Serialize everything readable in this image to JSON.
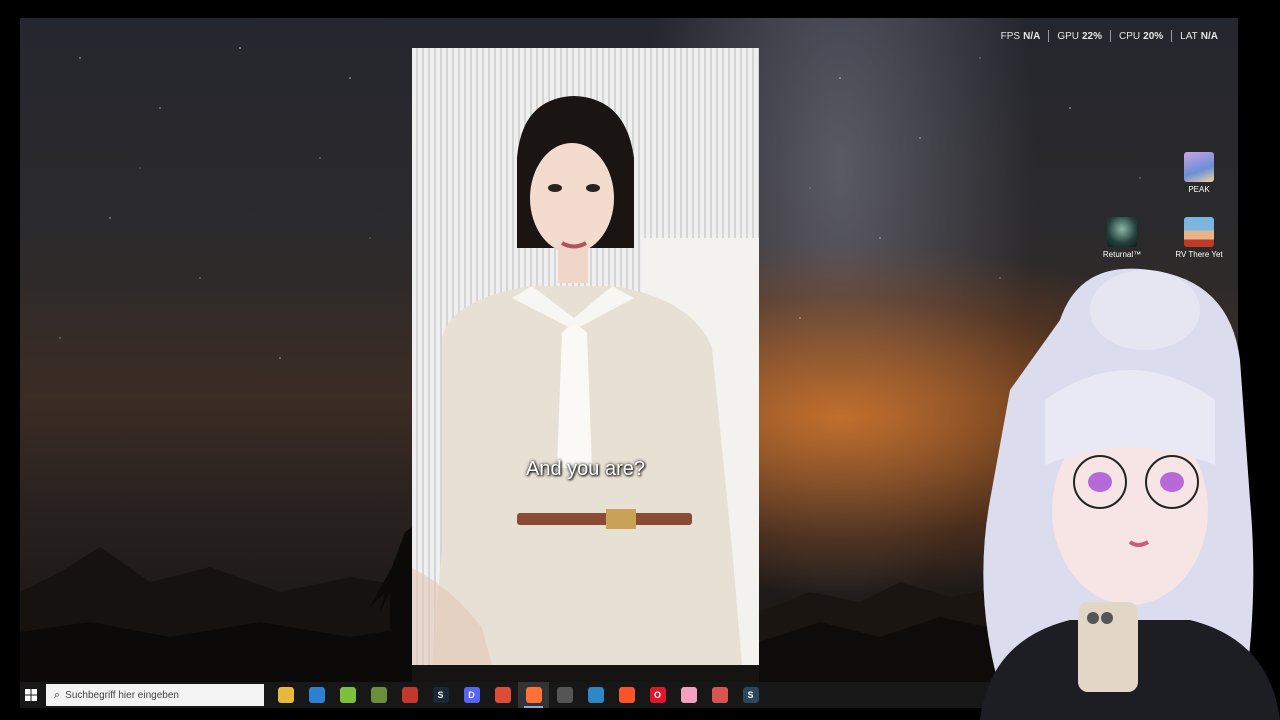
{
  "hud": {
    "fps_label": "FPS",
    "fps_value": "N/A",
    "gpu_label": "GPU",
    "gpu_value": "22%",
    "cpu_label": "CPU",
    "cpu_value": "20%",
    "lat_label": "LAT",
    "lat_value": "N/A"
  },
  "desktop_icons": [
    {
      "label": "PEAK",
      "icon": "peak-icon"
    },
    {
      "label": "Returnal™",
      "icon": "returnal-icon"
    },
    {
      "label": "RV There Yet",
      "icon": "rv-there-yet-icon"
    }
  ],
  "video": {
    "subtitle": "And you are?"
  },
  "taskbar": {
    "search_placeholder": "Suchbegriff hier eingeben",
    "apps": [
      {
        "name": "file-explorer-icon",
        "glyph": "",
        "color": "#e8b83a",
        "active": false
      },
      {
        "name": "ms-store-icon",
        "glyph": "",
        "color": "#2d7fd3",
        "active": false
      },
      {
        "name": "android-app-icon",
        "glyph": "",
        "color": "#7cbf3d",
        "active": false
      },
      {
        "name": "minecraft-icon",
        "glyph": "",
        "color": "#6a8e3a",
        "active": false
      },
      {
        "name": "notes-app-icon",
        "glyph": "",
        "color": "#c0392b",
        "active": false
      },
      {
        "name": "steam-icon",
        "glyph": "S",
        "color": "#1b2838",
        "active": false
      },
      {
        "name": "discord-icon",
        "glyph": "D",
        "color": "#5865f2",
        "active": false
      },
      {
        "name": "chrome-icon",
        "glyph": "",
        "color": "#dd4b39",
        "active": false
      },
      {
        "name": "firefox-icon",
        "glyph": "",
        "color": "#ff7139",
        "active": true
      },
      {
        "name": "dashboard-icon",
        "glyph": "",
        "color": "#555555",
        "active": false
      },
      {
        "name": "vpn-icon",
        "glyph": "",
        "color": "#2f86c7",
        "active": false
      },
      {
        "name": "brave-icon",
        "glyph": "",
        "color": "#fb542b",
        "active": false
      },
      {
        "name": "opera-icon",
        "glyph": "O",
        "color": "#e0162b",
        "active": false
      },
      {
        "name": "pink-app-icon",
        "glyph": "",
        "color": "#f4a1c1",
        "active": false
      },
      {
        "name": "tool-app-icon",
        "glyph": "",
        "color": "#d9534f",
        "active": false
      },
      {
        "name": "steam-alt-icon",
        "glyph": "S",
        "color": "#2a475e",
        "active": false
      }
    ]
  },
  "colors": {
    "sunset": "#d6762a",
    "taskbar": "#181818",
    "hud_text": "#e6e6e6"
  }
}
